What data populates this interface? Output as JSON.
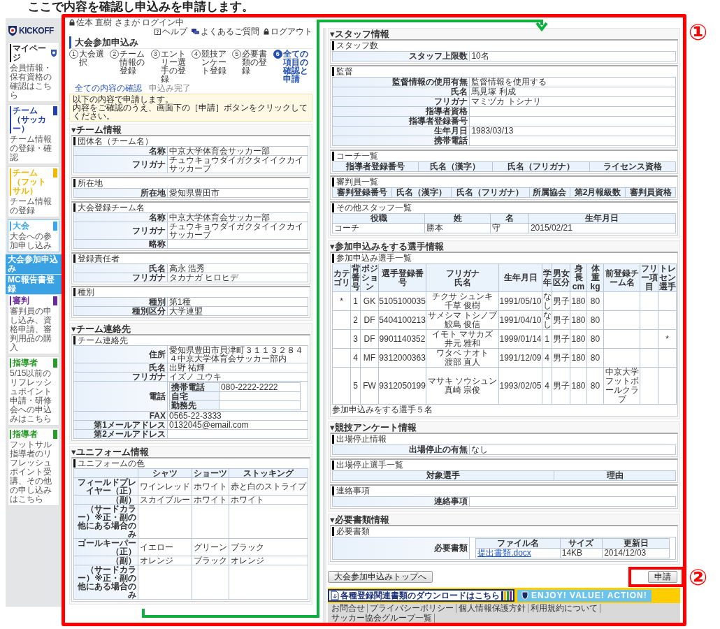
{
  "annotations": {
    "instruction": "ここで内容を確認し申込みを申請します。",
    "markers": [
      "①",
      "②"
    ]
  },
  "left_screen": {
    "sidebar": {
      "logo": "KICKOFF",
      "items": [
        {
          "title": "マイページ",
          "description": "会員情報・保有資格の確認はこちら",
          "selected": false
        },
        {
          "title": "チーム（サッカー）",
          "description": "チーム情報の登録・確認",
          "color": "#2341a8",
          "selected": false
        },
        {
          "title": "チーム（フットサル）",
          "description": "チーム情報の登録",
          "color": "#f0b800",
          "selected": false
        },
        {
          "title": "大会",
          "description": "大会への参加申し込み",
          "color": "#38a8e8",
          "selected": true,
          "subitems": [
            {
              "label": "大会参加申込み"
            },
            {
              "label": "MC報告書登録"
            }
          ]
        },
        {
          "title": "審判",
          "description": "審判員の申し込み、資格申請、審判用品の購入",
          "color": "#6a2a96",
          "selected": false
        },
        {
          "title": "指導者",
          "description": "5/15以前のリフレッシュポイント申請・研修会への申込みはこちら",
          "color": "#2a9a2a",
          "selected": false
        },
        {
          "title": "指導者",
          "description": "フットサル指導者のリフレッシュポイント受講、その他の申し込みはこちら",
          "color": "#2a9a2a",
          "selected": false
        }
      ]
    },
    "login_status": "佐本 直樹 さまが ログイン中",
    "header_links": [
      {
        "label": "ヘルプ",
        "kind": "help"
      },
      {
        "label": "よくあるご質問",
        "kind": "faq"
      },
      {
        "label": "ログアウト",
        "kind": "logout"
      }
    ],
    "page_title": "大会参加申込み",
    "steps": [
      {
        "number": "1",
        "label": "大会選択",
        "selected": false
      },
      {
        "number": "2",
        "label": "チーム情報の登録",
        "selected": false
      },
      {
        "number": "3",
        "label": "エントリー選手の登録",
        "selected": false
      },
      {
        "number": "4",
        "label": "競技アンケート登録",
        "selected": false
      },
      {
        "number": "5",
        "label": "必要書類の登録",
        "selected": false
      },
      {
        "number": "6",
        "label": "全ての項目の確認と申請",
        "selected": true
      }
    ],
    "breadcrumb": [
      {
        "label": "全ての内容の確認",
        "kind": "current"
      },
      {
        "label": "申込み完了",
        "kind": "pending"
      }
    ],
    "notice": [
      "以下の内容で申請します。",
      "内容をご確認のうえ、画面下の［申請］ボタンをクリックしてください。"
    ],
    "sections": [
      {
        "title": "▾チーム情報",
        "panels": [
          {
            "title": "団体名（チーム名）",
            "kind": "form",
            "rows": [
              {
                "label": "名称",
                "value": "中京大学体育会サッカー部"
              },
              {
                "label": "フリガナ",
                "value": "チュウキョウダイガクタイイクカイサッカーブ"
              }
            ]
          },
          {
            "title": "所在地",
            "kind": "form",
            "rows": [
              {
                "label": "所在地",
                "value": "愛知県豊田市"
              }
            ]
          },
          {
            "title": "大会登録チーム名",
            "kind": "form",
            "rows": [
              {
                "label": "名称",
                "value": "中京大学体育会サッカー部"
              },
              {
                "label": "フリガナ",
                "value": "チュウキョウダイガクタイイクカイサッカーブ"
              },
              {
                "label": "略称"
              }
            ]
          },
          {
            "title": "登録責任者",
            "kind": "form",
            "rows": [
              {
                "label": "氏名",
                "value": "高永 浩秀"
              },
              {
                "label": "フリガナ",
                "value": "タカナガ ヒロヒデ"
              }
            ]
          },
          {
            "title": "種別",
            "kind": "form",
            "rows": [
              {
                "label": "種別",
                "value": "第1種"
              },
              {
                "label": "種別区分",
                "value": "大学連盟"
              }
            ]
          }
        ]
      },
      {
        "title": "▾チーム連絡先",
        "panels": [
          {
            "title": "チーム連絡先",
            "kind": "form",
            "rows": [
              {
                "label": "住所",
                "value": "愛知県豊田市貝津町３１１３２８４４中京大学体育会サッカー部内"
              },
              {
                "label": "氏名",
                "value": "出野 祐輝"
              },
              {
                "label": "フリガナ",
                "value": "イズノ ユウキ"
              },
              {
                "label": "電話",
                "subrows": [
                  {
                    "label": "携帯電話",
                    "value": "080-2222-2222"
                  },
                  {
                    "label": "自宅"
                  },
                  {
                    "label": "勤務先"
                  }
                ]
              },
              {
                "label": "FAX",
                "value": "0565-22-3333"
              },
              {
                "label": "第1メールアドレス",
                "value": "0132045@email.com"
              },
              {
                "label": "第2メールアドレス"
              }
            ]
          }
        ]
      },
      {
        "title": "▾ユニフォーム情報",
        "panels": [
          {
            "title": "ユニフォームの色",
            "kind": "grid",
            "columns": [
              "シャツ",
              "ショーツ",
              "ストッキング"
            ],
            "rows": [
              {
                "label": "フィールドプレイヤー（正）",
                "cells": [
                  "ワインレッド",
                  "ホワイト",
                  "赤と白のストライプ"
                ]
              },
              {
                "label": "（副）",
                "cells": [
                  "スカイブルー",
                  "ホワイト",
                  "ホワイト"
                ]
              },
              {
                "label": "（サードカラー）※正・副の他にある場合のみ",
                "cells": [
                  null,
                  null,
                  null
                ]
              },
              {
                "label": "ゴールキーパー（正）",
                "cells": [
                  "イエロー",
                  "グリーン",
                  "ブラック"
                ]
              },
              {
                "label": "（副）",
                "cells": [
                  "オレンジ",
                  "ブラック",
                  "オレンジ"
                ]
              },
              {
                "label": "（サードカラー）※正・副の他にある場合のみ",
                "cells": [
                  null,
                  null,
                  null
                ]
              }
            ]
          }
        ]
      }
    ]
  },
  "right_screen": {
    "sections": [
      {
        "title": "▾スタッフ情報",
        "panels": [
          {
            "title": "スタッフ数",
            "kind": "form",
            "rows": [
              {
                "label": "スタッフ上限数",
                "value": "10名"
              }
            ]
          },
          {
            "title": "監督",
            "kind": "form",
            "rows": [
              {
                "label": "監督情報の使用有無",
                "value": "監督情報を使用する"
              },
              {
                "label": "氏名",
                "value": "馬見塚 利成"
              },
              {
                "label": "フリガナ",
                "value": "マミヅカ トシナリ"
              },
              {
                "label": "指導者資格"
              },
              {
                "label": "指導者登録番号"
              },
              {
                "label": "生年月日",
                "value": "1983/03/13"
              },
              {
                "label": "携帯電話"
              }
            ]
          },
          {
            "title": "コーチ一覧",
            "kind": "grid",
            "columns": [
              "指導者登録番号",
              "氏名（漢字）",
              "氏名（フリガナ）",
              "ライセンス資格"
            ]
          },
          {
            "title": "審判員一覧",
            "kind": "grid",
            "columns": [
              "審判登録番号",
              "氏名（漢字）",
              "氏名（フリガナ）",
              "所属協会",
              "第2月報級数",
              "審判員資格"
            ]
          },
          {
            "title": "その他スタッフ一覧",
            "kind": "grid",
            "columns": [
              "役職",
              "姓",
              "名",
              "生年月日"
            ],
            "rows": [
              {
                "cells": [
                  "コーチ",
                  "勝本",
                  "守",
                  "2015/02/21"
                ]
              }
            ]
          }
        ]
      },
      {
        "title": "▾参加申込みをする選手情報",
        "panels": [
          {
            "title": "参加申込み選手一覧",
            "kind": "roster",
            "columns": [
              "カテゴリ",
              "背番号",
              "ポジション",
              "選手登録番号",
              [
                "フリガナ",
                "氏名"
              ],
              "生年月日",
              "学年",
              "男女区分",
              "身長cm",
              "体重kg",
              "前登録チーム名",
              "フリー項目",
              "トレセン選手"
            ],
            "rows": [
              {
                "cells": [
                  "*",
                  "1",
                  "GK",
                  "5105100035",
                  [
                    "チクサ シュンキ",
                    "千草 俊樹"
                  ],
                  "1991/05/10",
                  "なし",
                  "男子",
                  "180",
                  "80",
                  null,
                  null,
                  null
                ]
              },
              {
                "cells": [
                  null,
                  "2",
                  "DF",
                  "5404100213",
                  [
                    "サメシマ トシノブ",
                    "鮫島 俊信"
                  ],
                  "1991/04/10",
                  "なし",
                  "男子",
                  "180",
                  "80",
                  null,
                  null,
                  null
                ]
              },
              {
                "cells": [
                  null,
                  "3",
                  "DF",
                  "9901140352",
                  [
                    "イモト マサカズ",
                    "井元 雅和"
                  ],
                  "1999/01/14",
                  "1",
                  "男子",
                  "180",
                  "80",
                  null,
                  null,
                  "*"
                ]
              },
              {
                "cells": [
                  null,
                  "4",
                  "MF",
                  "9312000363",
                  [
                    "ワタベ ナオト",
                    "渡部 直人"
                  ],
                  "1991/12/09",
                  "4",
                  "男子",
                  "180",
                  "80",
                  null,
                  null,
                  null
                ]
              },
              {
                "cells": [
                  null,
                  "5",
                  "FW",
                  "9312050199",
                  [
                    "マサキ ソウシュン",
                    "真崎 宗俊"
                  ],
                  "1993/02/05",
                  "4",
                  "男子",
                  "180",
                  "80",
                  "中京大学フットボールクラブ",
                  null,
                  null
                ]
              }
            ],
            "footer": "参加申込みをする選手５名"
          }
        ]
      },
      {
        "title": "▾競技アンケート情報",
        "panels": [
          {
            "title": "出場停止情報",
            "kind": "form",
            "rows": [
              {
                "label": "出場停止の有無",
                "value": "なし"
              }
            ]
          },
          {
            "title": "出場停止選手一覧",
            "kind": "grid",
            "columns": [
              "対象選手",
              "理由"
            ]
          },
          {
            "title": "連絡事項",
            "kind": "form",
            "rows": [
              {
                "label": "連絡事項"
              }
            ]
          }
        ]
      },
      {
        "title": "▾必要書類情報",
        "panels": [
          {
            "title": "必要書類",
            "kind": "form",
            "rows": [
              {
                "label": "必要書類",
                "table": {
                  "columns": [
                    "ファイル名",
                    "サイズ",
                    "更新日"
                  ],
                  "rows": [
                    {
                      "cells": [
                        {
                          "text": "提出書類.docx",
                          "kind": "link"
                        },
                        "14KB",
                        "2014/12/03"
                      ]
                    }
                  ]
                }
              }
            ]
          }
        ]
      }
    ],
    "buttons": [
      {
        "label": "大会参加申込みトップへ",
        "highlighted": false
      },
      {
        "label": "申請",
        "highlighted": true
      }
    ],
    "download_banner": "各種登録関連書類のダウンロードはこちら",
    "slogan_banner": "ENJOY! VALUE! ACTION!",
    "footer_links": [
      "お問合せ",
      "プライバシーポリシー",
      "個人情報保護方針",
      "利用規約について",
      "サッカー協会グループ一覧"
    ]
  }
}
